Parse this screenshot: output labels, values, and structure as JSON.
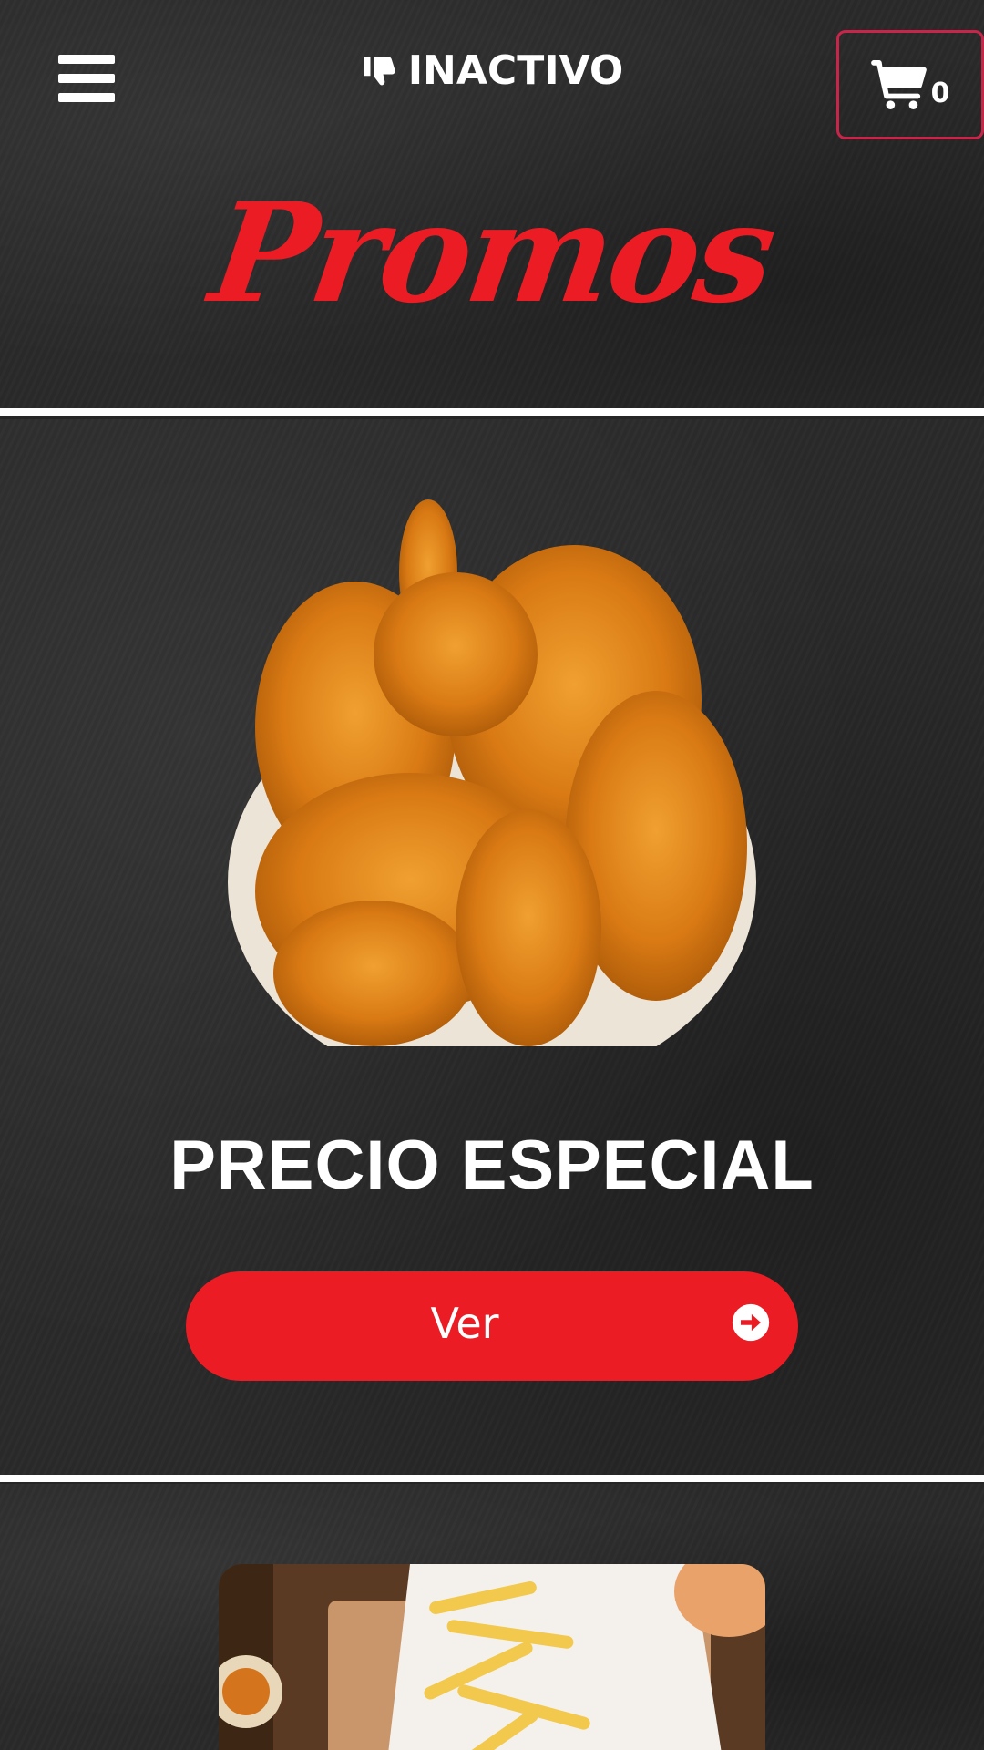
{
  "header": {
    "status_text": "INACTIVO",
    "status_icon": "thumbs-down-icon",
    "menu_icon": "hamburger-menu-icon",
    "cart_icon": "shopping-cart-icon",
    "cart_count": "0",
    "section_title": "Promos"
  },
  "colors": {
    "accent": "#ec1c24",
    "cart_border": "#c8254a",
    "background": "#2a2a2a",
    "text": "#ffffff"
  },
  "promos": [
    {
      "image": "fried-chicken-plate",
      "title": "PRECIO ESPECIAL",
      "button_label": "Ver",
      "button_icon": "arrow-circle-right-icon"
    },
    {
      "image": "french-fries-plate"
    }
  ]
}
